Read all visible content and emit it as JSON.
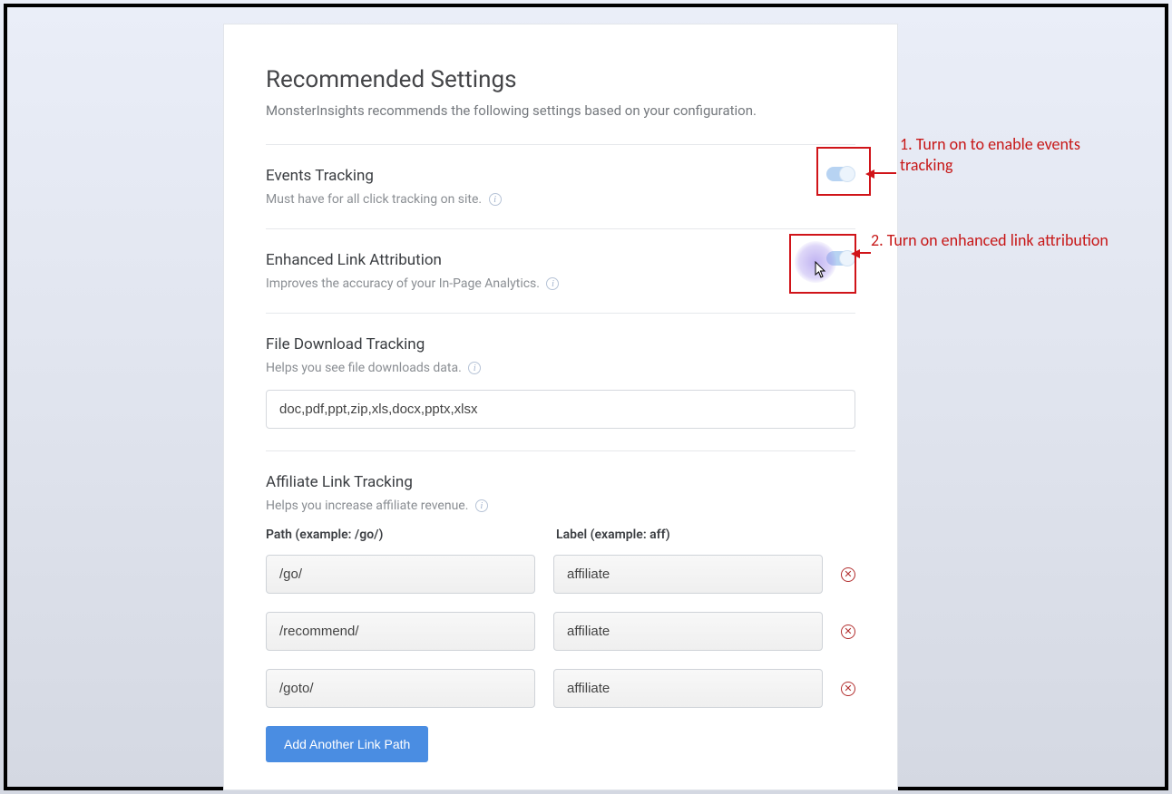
{
  "header": {
    "title": "Recommended Settings",
    "subtitle": "MonsterInsights recommends the following settings based on your configuration."
  },
  "settings": {
    "events": {
      "title": "Events Tracking",
      "desc": "Must have for all click tracking on site.",
      "enabled": true
    },
    "ela": {
      "title": "Enhanced Link Attribution",
      "desc": "Improves the accuracy of your In-Page Analytics.",
      "enabled": true
    },
    "downloads": {
      "title": "File Download Tracking",
      "desc": "Helps you see file downloads data.",
      "value": "doc,pdf,ppt,zip,xls,docx,pptx,xlsx"
    },
    "affiliate": {
      "title": "Affiliate Link Tracking",
      "desc": "Helps you increase affiliate revenue.",
      "path_header": "Path (example: /go/)",
      "label_header": "Label (example: aff)",
      "rows": [
        {
          "path": "/go/",
          "label": "affiliate"
        },
        {
          "path": "/recommend/",
          "label": "affiliate"
        },
        {
          "path": "/goto/",
          "label": "affiliate"
        }
      ],
      "add_label": "Add Another Link Path"
    }
  },
  "annotations": {
    "a1": "1. Turn on to enable events tracking",
    "a2": "2. Turn on enhanced link attribution"
  },
  "colors": {
    "annotation": "#c71717"
  }
}
